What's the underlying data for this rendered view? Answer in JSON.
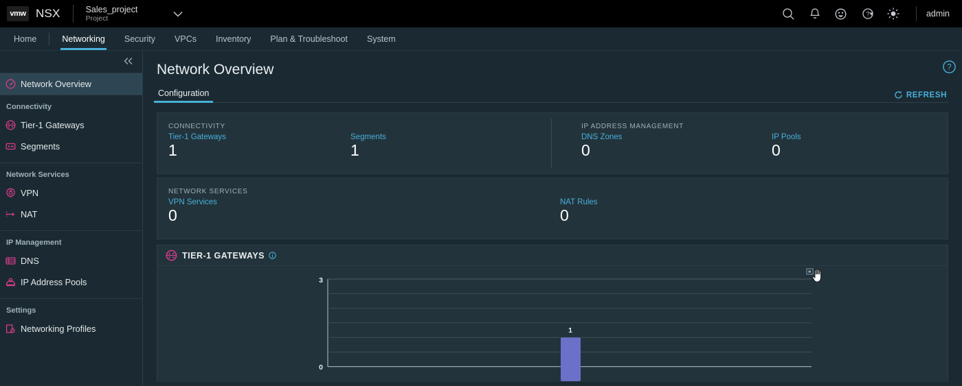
{
  "header": {
    "brand": "NSX",
    "logo_text": "vmw",
    "project_name": "Sales_project",
    "project_sub": "Project",
    "caret_icon": "chevron-down-icon",
    "icons": [
      {
        "name": "search-icon"
      },
      {
        "name": "bell-icon"
      },
      {
        "name": "smiley-icon"
      },
      {
        "name": "help-icon"
      },
      {
        "name": "theme-sun-icon"
      }
    ],
    "user": "admin"
  },
  "nav": {
    "items": [
      {
        "label": "Home",
        "active": false
      },
      {
        "label": "Networking",
        "active": true
      },
      {
        "label": "Security",
        "active": false
      },
      {
        "label": "VPCs",
        "active": false
      },
      {
        "label": "Inventory",
        "active": false
      },
      {
        "label": "Plan & Troubleshoot",
        "active": false
      },
      {
        "label": "System",
        "active": false
      }
    ]
  },
  "sidebar": {
    "collapse_icon": "chevron-double-left-icon",
    "overview": {
      "label": "Network Overview",
      "icon": "gauge-icon",
      "active": true
    },
    "groups": [
      {
        "title": "Connectivity",
        "items": [
          {
            "label": "Tier-1 Gateways",
            "icon": "tier1-gateway-icon"
          },
          {
            "label": "Segments",
            "icon": "segment-icon"
          }
        ]
      },
      {
        "title": "Network Services",
        "items": [
          {
            "label": "VPN",
            "icon": "vpn-lock-icon"
          },
          {
            "label": "NAT",
            "icon": "nat-arrow-icon"
          }
        ]
      },
      {
        "title": "IP Management",
        "items": [
          {
            "label": "DNS",
            "icon": "dns-table-icon"
          },
          {
            "label": "IP Address Pools",
            "icon": "ip-pool-icon"
          }
        ]
      },
      {
        "title": "Settings",
        "items": [
          {
            "label": "Networking Profiles",
            "icon": "profile-gear-icon"
          }
        ]
      }
    ]
  },
  "main": {
    "page_title": "Network Overview",
    "help_icon": "help-circle-icon",
    "tabs": [
      {
        "label": "Configuration",
        "active": true
      }
    ],
    "refresh_label": "REFRESH",
    "refresh_icon": "refresh-icon",
    "cards": [
      {
        "columns": [
          {
            "kicker": "CONNECTIVITY",
            "metrics": [
              {
                "label": "Tier-1 Gateways",
                "value": "1"
              },
              {
                "label": "Segments",
                "value": "1"
              }
            ]
          },
          {
            "kicker": "IP ADDRESS MANAGEMENT",
            "metrics": [
              {
                "label": "DNS Zones",
                "value": "0"
              },
              {
                "label": "IP Pools",
                "value": "0"
              }
            ]
          }
        ]
      },
      {
        "columns": [
          {
            "kicker": "NETWORK SERVICES",
            "metrics": [
              {
                "label": "VPN Services",
                "value": "0"
              },
              {
                "label": "NAT Rules",
                "value": "0"
              }
            ]
          }
        ]
      }
    ],
    "panel": {
      "title": "TIER-1 GATEWAYS",
      "icon": "tier1-gateway-icon",
      "info_icon": "info-circle-icon"
    }
  },
  "chart_data": {
    "type": "bar",
    "title": "TIER-1 GATEWAYS",
    "categories": [
      ""
    ],
    "values": [
      1
    ],
    "labels": [
      "1"
    ],
    "xlabel": "",
    "ylabel": "",
    "ylim": [
      0,
      3
    ],
    "yticks": [
      0,
      3
    ],
    "ytick_labels": [
      "0",
      "3"
    ],
    "gridlines": [
      0.5,
      1,
      1.5,
      2,
      2.5,
      3
    ],
    "grid": true,
    "legend": "none",
    "bar_color": "#6b70c8",
    "bar_value_label": "1"
  },
  "colors": {
    "accent_blue": "#49afd9",
    "accent_pink": "#d93c8c",
    "bar_purple": "#6b70c8",
    "page_bg": "#1b2a32",
    "card_bg": "#22333b",
    "sidebar_active": "#2e4654"
  },
  "cursor": {
    "name": "drag-pointer-cursor"
  }
}
